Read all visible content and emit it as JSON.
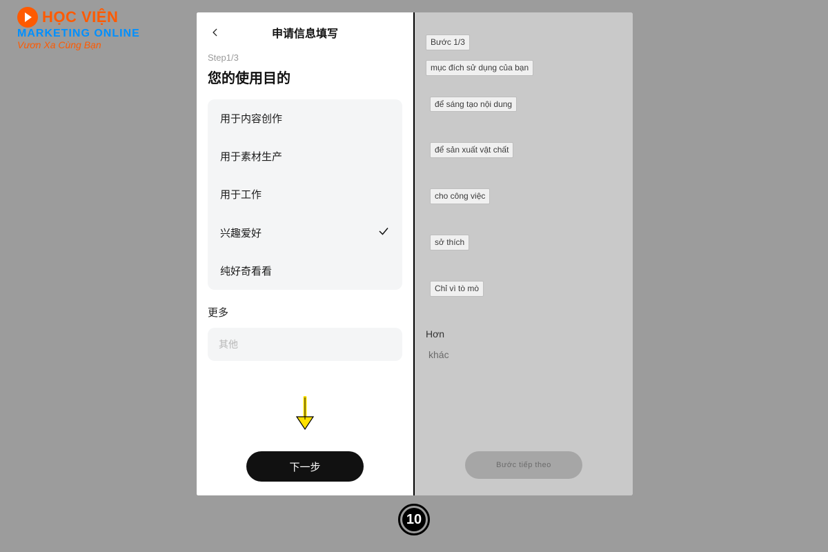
{
  "logo": {
    "line1_main": "HỌC VIỆN",
    "line2": "MARKETING ONLINE",
    "line3": "Vươn Xa Cùng Bạn"
  },
  "left": {
    "header_title": "申请信息填写",
    "step": "Step1/3",
    "question": "您的使用目的",
    "options": [
      {
        "label": "用于内容创作",
        "selected": false
      },
      {
        "label": "用于素材生产",
        "selected": false
      },
      {
        "label": "用于工作",
        "selected": false
      },
      {
        "label": "兴趣爱好",
        "selected": true
      },
      {
        "label": "纯好奇看看",
        "selected": false
      }
    ],
    "more_label": "更多",
    "other_placeholder": "其他",
    "next_button": "下一步"
  },
  "right": {
    "step": "Bước 1/3",
    "question": "mục đích sử dụng của bạn",
    "options": [
      "để sáng tạo nội dung",
      "để sản xuất vật chất",
      "cho công việc",
      "sở thích",
      "Chỉ vì tò mò"
    ],
    "more_label": "Hơn",
    "other_placeholder": "khác",
    "next_button": "Bước tiếp theo"
  },
  "step_badge": "10"
}
